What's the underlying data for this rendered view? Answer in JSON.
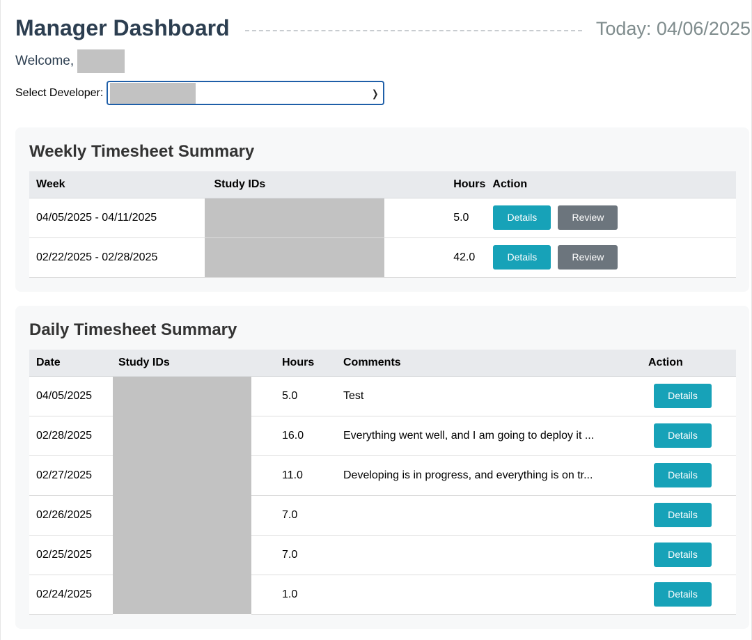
{
  "header": {
    "title": "Manager Dashboard",
    "today": "Today: 04/06/2025"
  },
  "welcome": {
    "label": "Welcome,"
  },
  "developer_select": {
    "label": "Select Developer:",
    "chevron_icon": "chevron-down-icon"
  },
  "weekly": {
    "heading": "Weekly Timesheet Summary",
    "columns": [
      "Week",
      "Study IDs",
      "Hours",
      "Action"
    ],
    "rows": [
      {
        "week": "04/05/2025 - 04/11/2025",
        "hours": "5.0"
      },
      {
        "week": "02/22/2025 - 02/28/2025",
        "hours": "42.0"
      }
    ],
    "details_label": "Details",
    "review_label": "Review"
  },
  "daily": {
    "heading": "Daily Timesheet Summary",
    "columns": [
      "Date",
      "Study IDs",
      "Hours",
      "Comments",
      "Action"
    ],
    "rows": [
      {
        "date": "04/05/2025",
        "hours": "5.0",
        "comment": "Test"
      },
      {
        "date": "02/28/2025",
        "hours": "16.0",
        "comment": "Everything went well, and I am going to deploy it ..."
      },
      {
        "date": "02/27/2025",
        "hours": "11.0",
        "comment": "Developing is in progress, and everything is on tr..."
      },
      {
        "date": "02/26/2025",
        "hours": "7.0",
        "comment": ""
      },
      {
        "date": "02/25/2025",
        "hours": "7.0",
        "comment": ""
      },
      {
        "date": "02/24/2025",
        "hours": "1.0",
        "comment": ""
      }
    ],
    "details_label": "Details"
  },
  "colors": {
    "title": "#2c3e50",
    "details_button": "#17a2b8",
    "review_button": "#6c757d",
    "select_border": "#1f5fa8",
    "redaction": "#c2c2c2"
  }
}
